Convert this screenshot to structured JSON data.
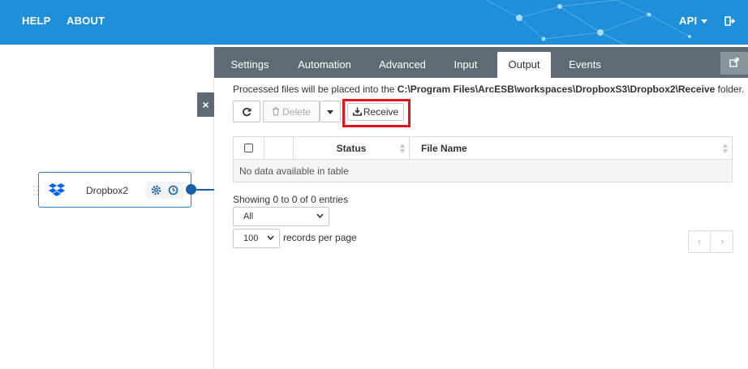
{
  "topnav": {
    "help": "HELP",
    "about": "ABOUT",
    "api": "API"
  },
  "canvas": {
    "close_label": "×",
    "connector": {
      "name": "Dropbox2"
    }
  },
  "tabs": [
    {
      "label": "Settings"
    },
    {
      "label": "Automation"
    },
    {
      "label": "Advanced"
    },
    {
      "label": "Input"
    },
    {
      "label": "Output"
    },
    {
      "label": "Events"
    }
  ],
  "active_tab": "Output",
  "output": {
    "info_prefix": "Processed files will be placed into the ",
    "info_path": "C:\\Program Files\\ArcESB\\workspaces\\DropboxS3\\Dropbox2\\Receive",
    "info_suffix": " folder.",
    "delete_label": "Delete",
    "receive_label": "Receive",
    "columns": [
      "",
      "",
      "Status",
      "File Name"
    ],
    "empty_message": "No data available in table",
    "showing_text": "Showing 0 to 0 of 0 entries",
    "filter_value": "All",
    "page_size_value": "100",
    "page_size_suffix": "records per page",
    "prev_label": "‹",
    "next_label": "›"
  },
  "colors": {
    "topbar": "#1f8fd9",
    "tabbar": "#5f6b73",
    "highlight": "#e3121b",
    "connector_border": "#2f7fc4"
  }
}
